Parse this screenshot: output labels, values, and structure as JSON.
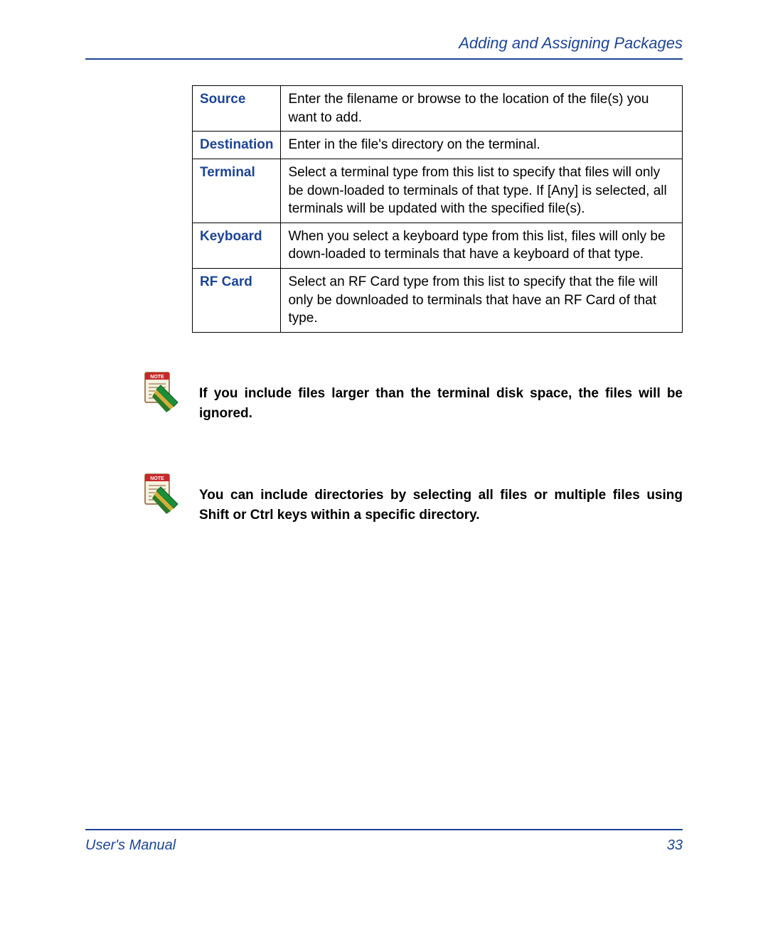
{
  "header": {
    "title": "Adding and Assigning Packages"
  },
  "table": {
    "rows": [
      {
        "label": "Source",
        "desc": "Enter the filename or browse to the location of the file(s) you want to add."
      },
      {
        "label": "Destination",
        "desc": "Enter in the file's directory on the terminal."
      },
      {
        "label": "Terminal",
        "desc": "Select a terminal type from this list to specify that files will only be down-loaded to terminals of that type. If [Any] is selected, all terminals will be updated with the specified file(s)."
      },
      {
        "label": "Keyboard",
        "desc": "When you select a keyboard type from this list, files will only be down-loaded to terminals that have a keyboard of that type."
      },
      {
        "label": "RF Card",
        "desc": "Select an RF Card type from this list to specify that the file will only be downloaded to terminals that have an RF Card of that type."
      }
    ]
  },
  "notes": [
    {
      "text": "If you include files larger than the terminal disk space, the files will be ignored."
    },
    {
      "text": "You can include directories by selecting all files or multiple files using Shift or Ctrl keys within a specific directory."
    }
  ],
  "footer": {
    "left": "User's Manual",
    "right": "33"
  }
}
